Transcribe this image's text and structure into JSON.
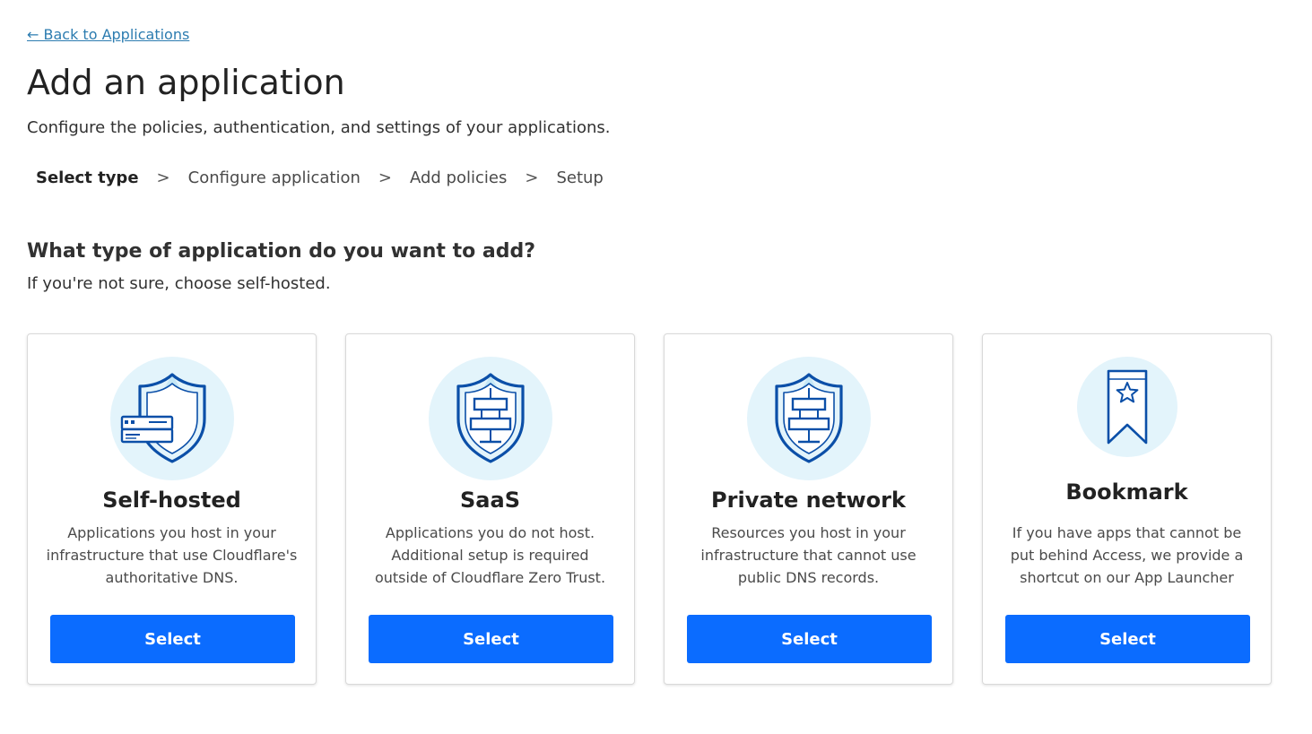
{
  "nav": {
    "back_link": "← Back to Applications"
  },
  "header": {
    "title": "Add an application",
    "subtitle": "Configure the policies, authentication, and settings of your applications."
  },
  "steps": {
    "items": [
      {
        "label": "Select type",
        "active": true
      },
      {
        "label": "Configure application",
        "active": false
      },
      {
        "label": "Add policies",
        "active": false
      },
      {
        "label": "Setup",
        "active": false
      }
    ],
    "separator": ">"
  },
  "question": {
    "title": "What type of application do you want to add?",
    "hint": "If you're not sure, choose self-hosted."
  },
  "cards": [
    {
      "icon": "shield-server-icon",
      "title": "Self-hosted",
      "desc_lines": [
        "Applications you host in your",
        "infrastructure that use Cloudflare's",
        "authoritative DNS."
      ],
      "button": "Select"
    },
    {
      "icon": "shield-network-icon",
      "title": "SaaS",
      "desc_lines": [
        "Applications you do not host.",
        "Additional setup is required",
        "outside of Cloudflare Zero Trust."
      ],
      "button": "Select"
    },
    {
      "icon": "shield-network-icon",
      "title": "Private network",
      "desc_lines": [
        "Resources you host in your",
        "infrastructure that cannot use",
        "public DNS records."
      ],
      "button": "Select"
    },
    {
      "icon": "bookmark-star-icon",
      "title": "Bookmark",
      "desc_lines": [
        "If you have apps that cannot be",
        "put behind Access, we provide a",
        "shortcut on our App Launcher"
      ],
      "button": "Select"
    }
  ],
  "colors": {
    "accent": "#0b6cff",
    "link": "#2c7cb0",
    "icon_stroke": "#0b4fa8",
    "icon_bg": "#e3f4fb"
  }
}
